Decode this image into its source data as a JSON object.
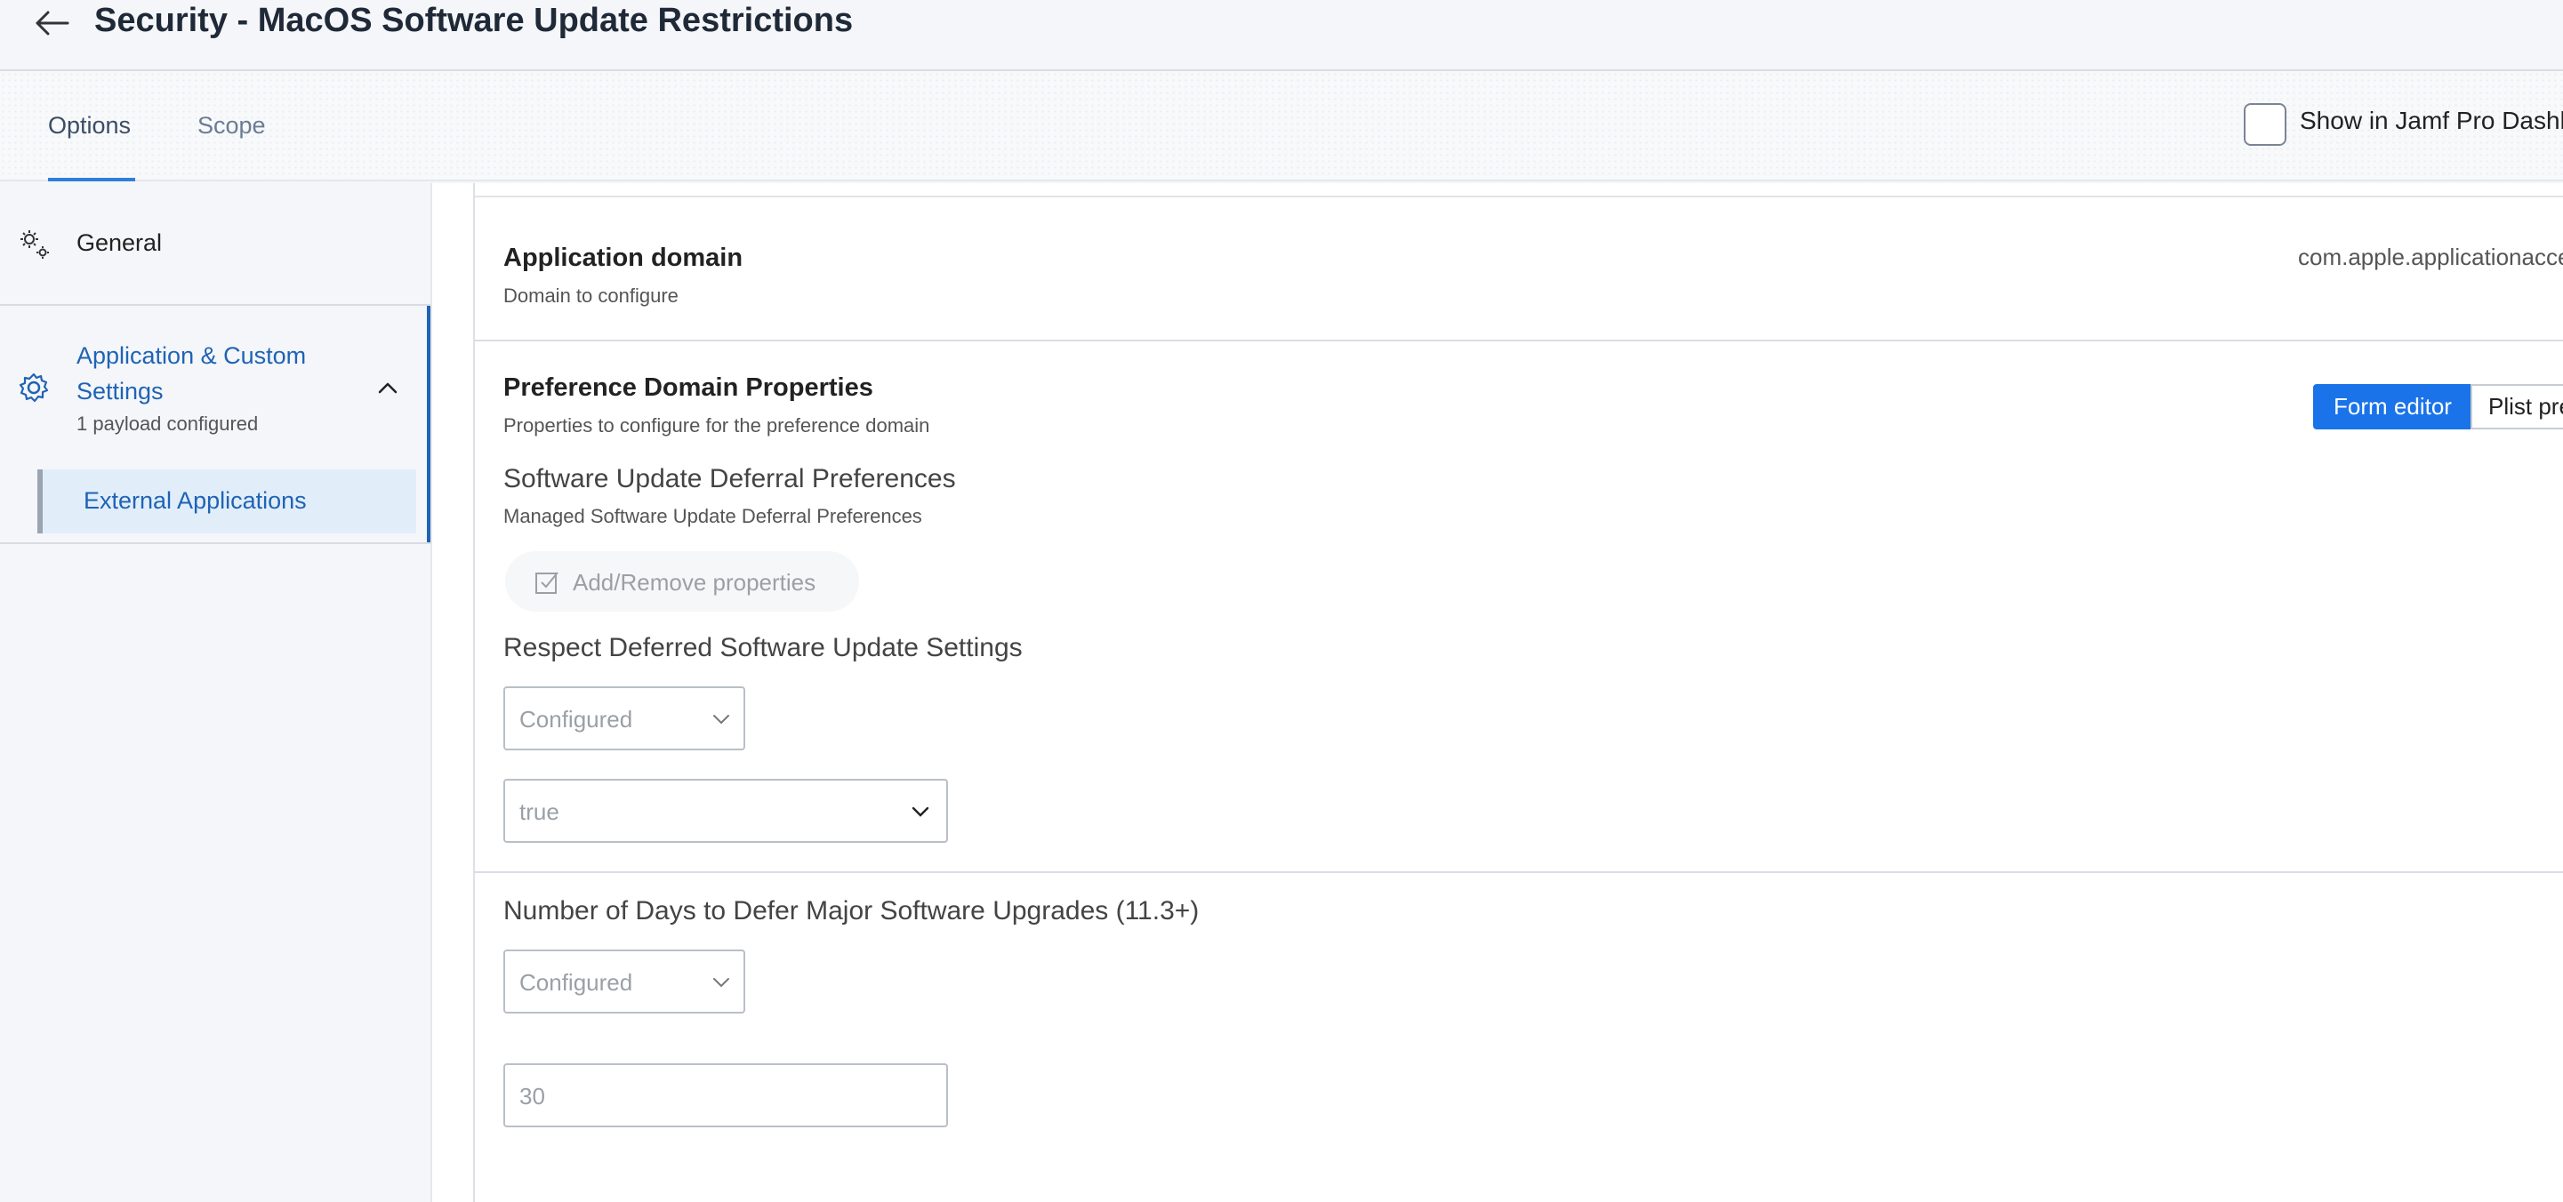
{
  "header": {
    "title": "Security - MacOS Software Update Restrictions"
  },
  "tabs": [
    {
      "label": "Options"
    },
    {
      "label": "Scope"
    }
  ],
  "dashboard": {
    "label": "Show in Jamf Pro Dashboard",
    "checked": false
  },
  "sidebar": {
    "general": {
      "label": "General"
    },
    "app_settings": {
      "label": "Application & Custom Settings",
      "subtitle": "1 payload configured",
      "child": {
        "label": "External Applications"
      }
    }
  },
  "main": {
    "application_domain": {
      "title": "Application domain",
      "subtitle": "Domain to configure",
      "value": "com.apple.applicationaccess"
    },
    "preference_domain": {
      "title": "Preference Domain Properties",
      "subtitle": "Properties to configure for the preference domain",
      "form_editor_label": "Form editor",
      "plist_label": "Plist preview"
    },
    "deferral": {
      "title": "Software Update Deferral Preferences",
      "subtitle": "Managed Software Update Deferral Preferences",
      "add_remove_label": "Add/Remove properties"
    },
    "properties": [
      {
        "label": "Respect Deferred Software Update Settings",
        "state": "Configured",
        "value": "true"
      },
      {
        "label": "Number of Days to Defer Major Software Upgrades (11.3+)",
        "state": "Configured",
        "value": "30"
      }
    ]
  },
  "colors": {
    "accent": "#1a73e8",
    "sidebar_active": "#1f63b5"
  }
}
